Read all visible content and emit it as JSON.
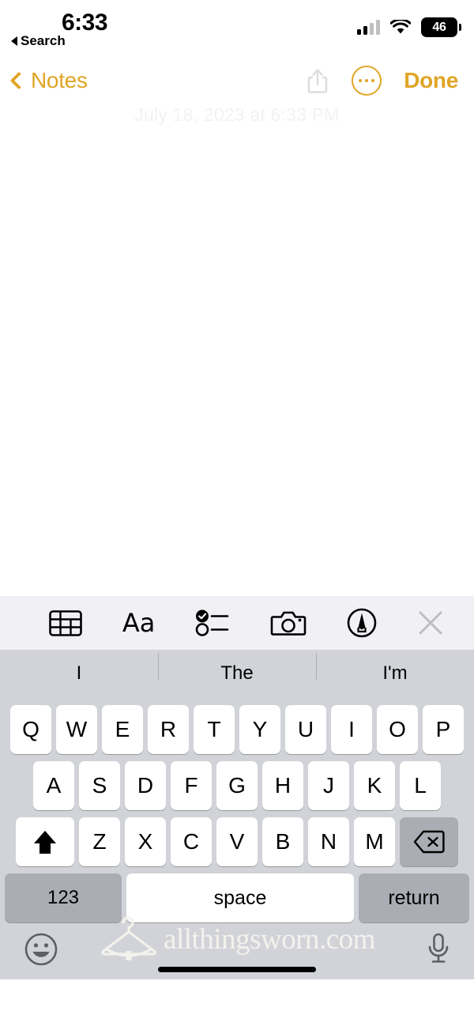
{
  "status_bar": {
    "time": "6:33",
    "back_to_app_label": "Search",
    "signal_icon": "cellular-signal-icon",
    "signal_bars_filled": 2,
    "signal_bars_total": 4,
    "wifi_icon": "wifi-icon",
    "battery_percent": "46",
    "battery_icon": "battery-icon"
  },
  "nav_bar": {
    "back_label": "Notes",
    "back_icon": "chevron-left-icon",
    "share_icon": "share-icon",
    "more_icon": "more-ellipsis-circle-icon",
    "done_label": "Done",
    "accent_color": "#E0A526",
    "share_disabled_color": "#DCDCDC"
  },
  "note": {
    "date_text": "July 18, 2023 at 6:33 PM",
    "body_text": "",
    "background_color": "#FFFFFF"
  },
  "format_toolbar": {
    "background_color": "#F1F0F4",
    "items": [
      {
        "name": "table-icon",
        "label": "Table"
      },
      {
        "name": "format-aa-icon",
        "label": "Aa"
      },
      {
        "name": "checklist-icon",
        "label": "Checklist"
      },
      {
        "name": "camera-icon",
        "label": "Camera"
      },
      {
        "name": "markup-pen-icon",
        "label": "Markup"
      },
      {
        "name": "close-icon",
        "label": "Close"
      }
    ]
  },
  "keyboard": {
    "background_color": "#D1D3D9",
    "key_color": "#FFFFFF",
    "function_key_color": "#AAADB4",
    "predictions": [
      "I",
      "The",
      "I'm"
    ],
    "row1": [
      "Q",
      "W",
      "E",
      "R",
      "T",
      "Y",
      "U",
      "I",
      "O",
      "P"
    ],
    "row2": [
      "A",
      "S",
      "D",
      "F",
      "G",
      "H",
      "J",
      "K",
      "L"
    ],
    "row3_letters": [
      "Z",
      "X",
      "C",
      "V",
      "B",
      "N",
      "M"
    ],
    "shift_icon": "shift-up-arrow-icon",
    "delete_icon": "backspace-delete-icon",
    "numbers_label": "123",
    "space_label": "space",
    "return_label": "return",
    "emoji_icon": "emoji-smiley-icon",
    "dictation_icon": "microphone-icon",
    "home_indicator": "home-indicator-bar"
  },
  "watermark": {
    "text": "allthingsworn.com",
    "logo_icon": "clothes-hanger-icon",
    "color": "#F4F2EC"
  }
}
